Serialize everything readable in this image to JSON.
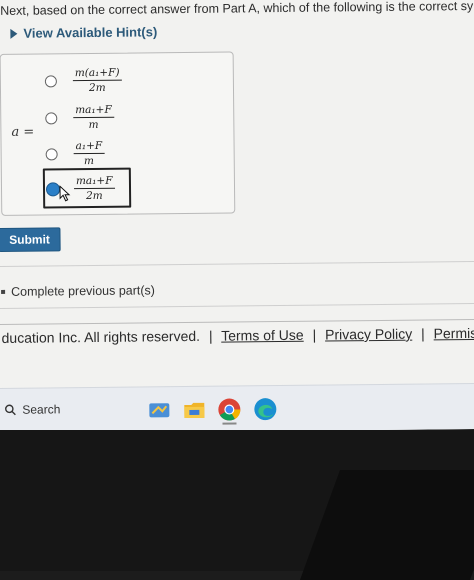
{
  "question": {
    "text": "Next, based on the correct answer from Part A, which of the following is the correct symbolic expres"
  },
  "hints": {
    "label": "View Available Hint(s)"
  },
  "answer": {
    "variable_label": "a =",
    "options": [
      {
        "numerator": "m(a₁+F)",
        "denominator": "2m",
        "selected": false
      },
      {
        "numerator": "ma₁+F",
        "denominator": "m",
        "selected": false
      },
      {
        "numerator": "a₁+F",
        "denominator": "m",
        "selected": false
      },
      {
        "numerator": "ma₁+F",
        "denominator": "2m",
        "selected": true
      }
    ]
  },
  "submit": {
    "label": "Submit"
  },
  "previous": {
    "label": "Complete previous part(s)"
  },
  "footer": {
    "copyright": "ducation Inc. All rights reserved.",
    "separator": "|",
    "links": [
      "Terms of Use",
      "Privacy Policy",
      "Permissions"
    ]
  },
  "taskbar": {
    "search_label": "Search",
    "icons": [
      "whiteboard-icon",
      "file-explorer-icon",
      "chrome-icon",
      "edge-icon"
    ]
  },
  "colors": {
    "accent": "#2c6a9c",
    "hint_text": "#2d5a7a",
    "radio_selected": "#2a7fc7"
  }
}
